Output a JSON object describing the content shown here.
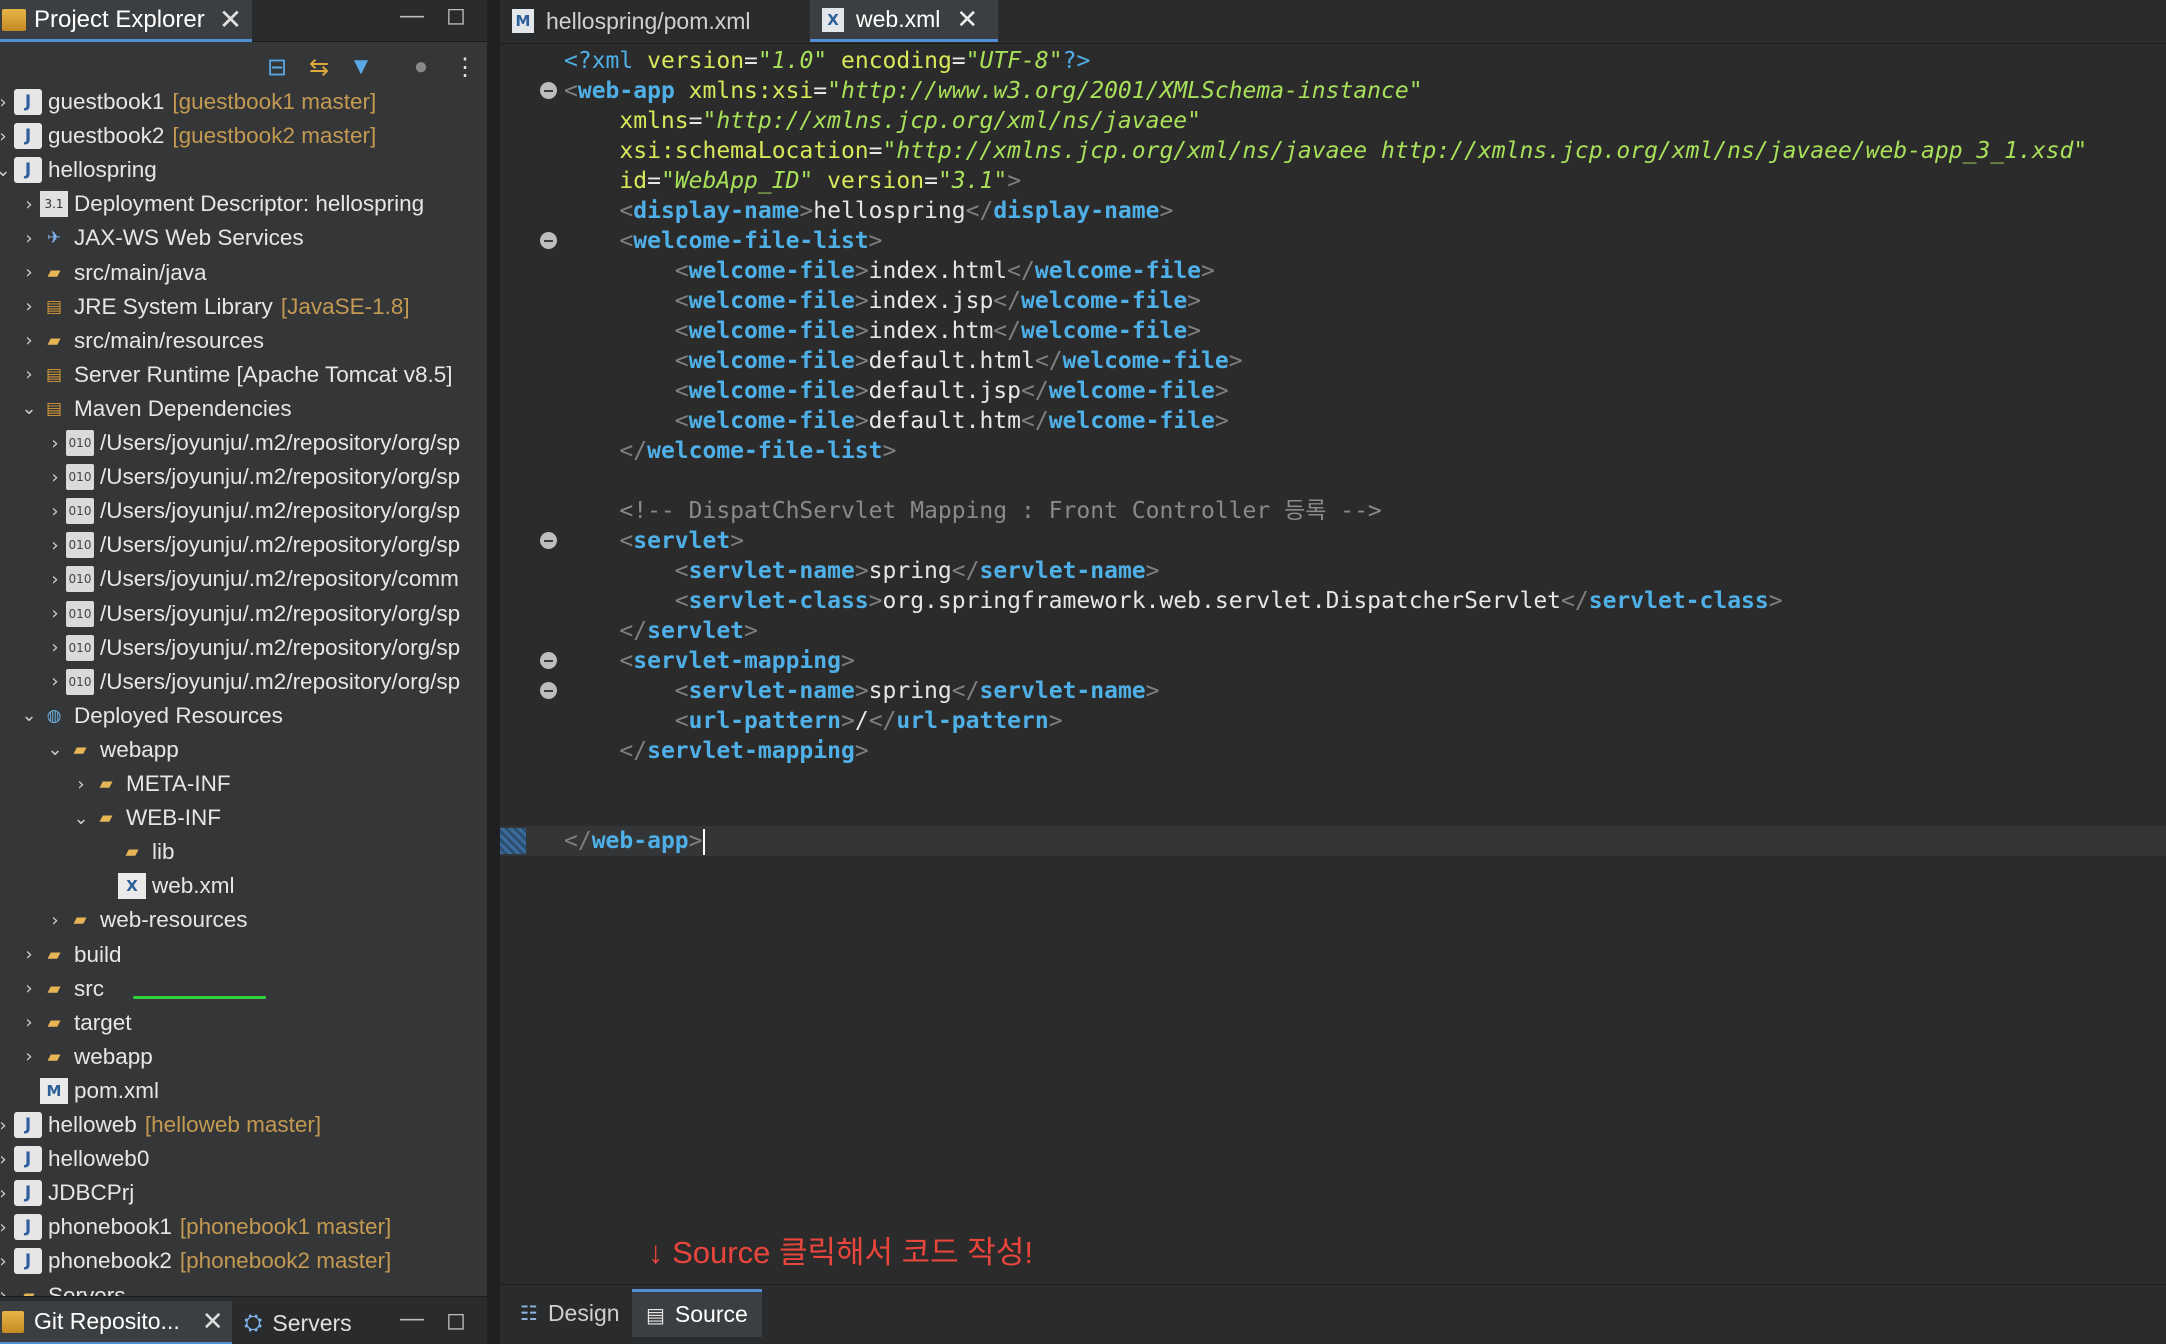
{
  "project_explorer": {
    "tab_label": "Project Explorer",
    "close_glyph": "✕",
    "minimize_glyph": "▭",
    "maximize_glyph": "□",
    "tree": [
      {
        "label": "guestbook1",
        "decoration": "[guestbook1 master]",
        "icon": "project-icon"
      },
      {
        "label": "guestbook2",
        "decoration": "[guestbook2 master]",
        "icon": "project-icon"
      },
      {
        "label": "hellospring",
        "decoration": "",
        "icon": "project-icon"
      },
      {
        "label": "Deployment Descriptor: hellospring",
        "decoration": "",
        "icon": "deployment-descriptor-icon"
      },
      {
        "label": "JAX-WS Web Services",
        "decoration": "",
        "icon": "web-services-icon"
      },
      {
        "label": "src/main/java",
        "decoration": "",
        "icon": "source-folder-icon"
      },
      {
        "label": "JRE System Library",
        "decoration": "[JavaSE-1.8]",
        "icon": "library-icon"
      },
      {
        "label": "src/main/resources",
        "decoration": "",
        "icon": "source-folder-icon"
      },
      {
        "label": "Server Runtime [Apache Tomcat v8.5]",
        "decoration": "",
        "icon": "library-icon"
      },
      {
        "label": "Maven Dependencies",
        "decoration": "",
        "icon": "library-icon"
      },
      {
        "label": "/Users/joyunju/.m2/repository/org/sp",
        "decoration": "",
        "icon": "jar-icon"
      },
      {
        "label": "/Users/joyunju/.m2/repository/org/sp",
        "decoration": "",
        "icon": "jar-icon"
      },
      {
        "label": "/Users/joyunju/.m2/repository/org/sp",
        "decoration": "",
        "icon": "jar-icon"
      },
      {
        "label": "/Users/joyunju/.m2/repository/org/sp",
        "decoration": "",
        "icon": "jar-icon"
      },
      {
        "label": "/Users/joyunju/.m2/repository/comm",
        "decoration": "",
        "icon": "jar-icon"
      },
      {
        "label": "/Users/joyunju/.m2/repository/org/sp",
        "decoration": "",
        "icon": "jar-icon"
      },
      {
        "label": "/Users/joyunju/.m2/repository/org/sp",
        "decoration": "",
        "icon": "jar-icon"
      },
      {
        "label": "/Users/joyunju/.m2/repository/org/sp",
        "decoration": "",
        "icon": "jar-icon"
      },
      {
        "label": "Deployed Resources",
        "decoration": "",
        "icon": "deployed-resources-icon"
      },
      {
        "label": "webapp",
        "decoration": "",
        "icon": "folder-icon"
      },
      {
        "label": "META-INF",
        "decoration": "",
        "icon": "folder-icon"
      },
      {
        "label": "WEB-INF",
        "decoration": "",
        "icon": "folder-icon"
      },
      {
        "label": "lib",
        "decoration": "",
        "icon": "folder-icon"
      },
      {
        "label": "web.xml",
        "decoration": "",
        "icon": "xml-file-icon"
      },
      {
        "label": "web-resources",
        "decoration": "",
        "icon": "folder-icon"
      },
      {
        "label": "build",
        "decoration": "",
        "icon": "folder-icon"
      },
      {
        "label": "src",
        "decoration": "",
        "icon": "folder-icon"
      },
      {
        "label": "target",
        "decoration": "",
        "icon": "folder-icon"
      },
      {
        "label": "webapp",
        "decoration": "",
        "icon": "folder-icon"
      },
      {
        "label": "pom.xml",
        "decoration": "",
        "icon": "maven-file-icon"
      },
      {
        "label": "helloweb",
        "decoration": "[helloweb master]",
        "icon": "project-icon"
      },
      {
        "label": "helloweb0",
        "decoration": "",
        "icon": "project-icon"
      },
      {
        "label": "JDBCPrj",
        "decoration": "",
        "icon": "project-icon"
      },
      {
        "label": "phonebook1",
        "decoration": "[phonebook1 master]",
        "icon": "project-icon"
      },
      {
        "label": "phonebook2",
        "decoration": "[phonebook2 master]",
        "icon": "project-icon"
      },
      {
        "label": "Servers",
        "decoration": "",
        "icon": "folder-icon"
      }
    ]
  },
  "bottom_left": {
    "git_tab_label": "Git Reposito...",
    "servers_tab_label": "Servers"
  },
  "editor": {
    "tabs": [
      {
        "label": "hellospring/pom.xml",
        "active": false
      },
      {
        "label": "web.xml",
        "active": true
      }
    ],
    "comment_text": "DispatChServlet Mapping : Front Controller 등록",
    "bottom_tabs": [
      {
        "label": "Design",
        "active": false
      },
      {
        "label": "Source",
        "active": true
      }
    ]
  },
  "annotation": "↓ Source 클릭해서 코드 작성!",
  "colors": {
    "accent": "#4e8fd6",
    "annotation_red": "#e8453c",
    "git_decoration": "#c49a52",
    "xml_tag": "#4fb0e8",
    "xml_string": "#a8e05a"
  }
}
